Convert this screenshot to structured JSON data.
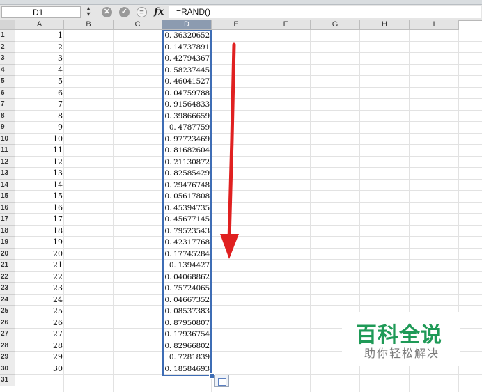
{
  "formula_bar": {
    "name_box": "D1",
    "formula": "=RAND()",
    "fx_label": "fx"
  },
  "columns": [
    "A",
    "B",
    "C",
    "D",
    "E",
    "F",
    "G",
    "H",
    "I"
  ],
  "selected_column": "D",
  "rows": [
    "1",
    "2",
    "3",
    "4",
    "5",
    "6",
    "7",
    "8",
    "9",
    "10",
    "11",
    "12",
    "13",
    "14",
    "15",
    "16",
    "17",
    "18",
    "19",
    "20",
    "21",
    "22",
    "23",
    "24",
    "25",
    "26",
    "27",
    "28",
    "29",
    "30",
    "31"
  ],
  "column_a": [
    "1",
    "2",
    "3",
    "4",
    "5",
    "6",
    "7",
    "8",
    "9",
    "10",
    "11",
    "12",
    "13",
    "14",
    "15",
    "16",
    "17",
    "18",
    "19",
    "20",
    "21",
    "22",
    "23",
    "24",
    "25",
    "26",
    "27",
    "28",
    "29",
    "30"
  ],
  "column_d": [
    "0. 36320652",
    "0. 14737891",
    "0. 42794367",
    "0. 58237445",
    "0. 46041527",
    "0. 04759788",
    "0. 91564833",
    "0. 39866659",
    "0. 4787759",
    "0. 97723469",
    "0. 81682604",
    "0. 21130872",
    "0. 82585429",
    "0. 29476748",
    "0. 05617808",
    "0. 45394735",
    "0. 45677145",
    "0. 79523543",
    "0. 42317768",
    "0. 17745284",
    "0. 1394427",
    "0. 04068862",
    "0. 75724065",
    "0. 04667352",
    "0. 08537383",
    "0. 87950807",
    "0. 17936754",
    "0. 82966802",
    "0. 7281839",
    "0. 18584693"
  ],
  "annotation": {
    "arrow_color": "#e02020"
  },
  "watermark": {
    "title": "百科全说",
    "subtitle": "助你轻松解决",
    "title_color": "#1f9a57"
  }
}
